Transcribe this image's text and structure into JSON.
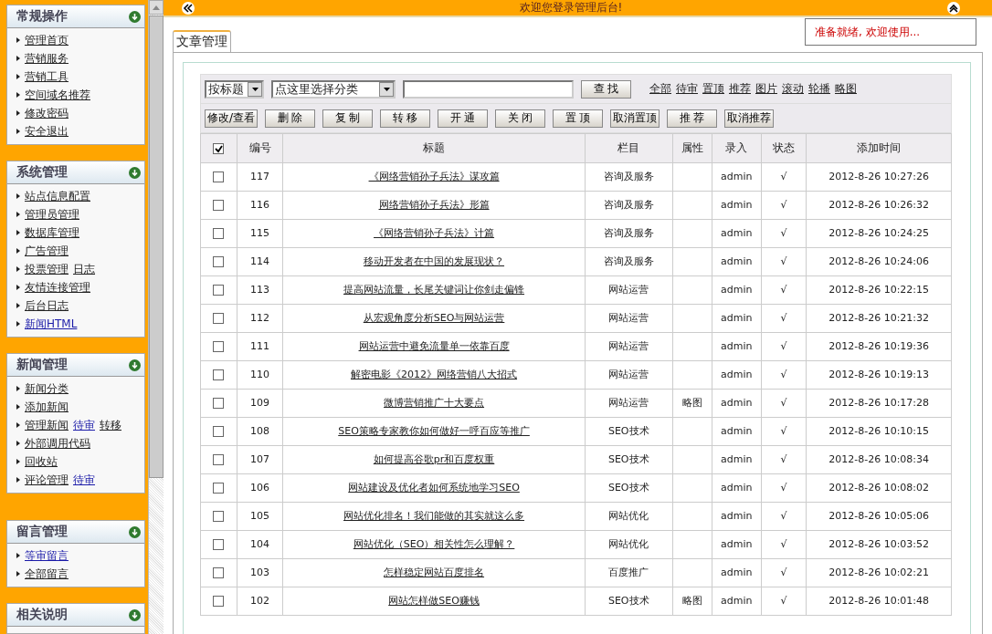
{
  "sidebar": {
    "sections": [
      {
        "title": "常规操作",
        "items": [
          {
            "links": [
              {
                "text": "管理首页",
                "highlighted": false
              }
            ]
          },
          {
            "links": [
              {
                "text": "营销服务",
                "highlighted": false
              }
            ]
          },
          {
            "links": [
              {
                "text": "营销工具",
                "highlighted": false
              }
            ]
          },
          {
            "links": [
              {
                "text": "空间域名推荐",
                "highlighted": false
              }
            ]
          },
          {
            "links": [
              {
                "text": "修改密码",
                "highlighted": false
              }
            ]
          },
          {
            "links": [
              {
                "text": "安全退出",
                "highlighted": false
              }
            ]
          }
        ]
      },
      {
        "title": "系统管理",
        "items": [
          {
            "links": [
              {
                "text": "站点信息配置",
                "highlighted": false
              }
            ]
          },
          {
            "links": [
              {
                "text": "管理员管理",
                "highlighted": false
              }
            ]
          },
          {
            "links": [
              {
                "text": "数据库管理",
                "highlighted": false
              }
            ]
          },
          {
            "links": [
              {
                "text": "广告管理",
                "highlighted": false
              }
            ]
          },
          {
            "links": [
              {
                "text": "投票管理",
                "highlighted": false
              },
              {
                "text": "日志",
                "highlighted": false
              }
            ]
          },
          {
            "links": [
              {
                "text": "友情连接管理",
                "highlighted": false
              }
            ]
          },
          {
            "links": [
              {
                "text": "后台日志",
                "highlighted": false
              }
            ]
          },
          {
            "links": [
              {
                "text": "新闻HTML",
                "highlighted": true
              }
            ]
          }
        ]
      },
      {
        "title": "新闻管理",
        "items": [
          {
            "links": [
              {
                "text": "新闻分类",
                "highlighted": false
              }
            ]
          },
          {
            "links": [
              {
                "text": "添加新闻",
                "highlighted": false
              }
            ]
          },
          {
            "links": [
              {
                "text": "管理新闻",
                "highlighted": false
              },
              {
                "text": "待审",
                "highlighted": true
              },
              {
                "text": "转移",
                "highlighted": false
              }
            ]
          },
          {
            "links": [
              {
                "text": "外部调用代码",
                "highlighted": false
              }
            ]
          },
          {
            "links": [
              {
                "text": "回收站",
                "highlighted": false
              }
            ]
          },
          {
            "links": [
              {
                "text": "评论管理",
                "highlighted": false
              },
              {
                "text": "待审",
                "highlighted": true
              }
            ]
          }
        ]
      },
      {
        "title": "留言管理",
        "items": [
          {
            "links": [
              {
                "text": "等审留言",
                "highlighted": true
              }
            ]
          },
          {
            "links": [
              {
                "text": "全部留言",
                "highlighted": false
              }
            ]
          }
        ]
      },
      {
        "title": "相关说明"
      }
    ]
  },
  "header": {
    "title": "欢迎您登录管理后台!"
  },
  "status": "准备就绪, 欢迎使用...",
  "tab": {
    "label": "文章管理",
    "selected": true
  },
  "search": {
    "field_select": "按标题",
    "category_select": "点这里选择分类",
    "button": "查 找",
    "filters": [
      "全部",
      "待审",
      "置顶",
      "推荐",
      "图片",
      "滚动",
      "轮播",
      "略图"
    ]
  },
  "actions": [
    "修改/查看",
    "删 除",
    "复 制",
    "转 移",
    "开 通",
    "关 闭",
    "置 顶",
    "取消置顶",
    "推 荐",
    "取消推荐"
  ],
  "table": {
    "header_checked": true,
    "columns": [
      "编号",
      "标题",
      "栏目",
      "属性",
      "录入",
      "状态",
      "添加时间"
    ],
    "rows": [
      {
        "checked": false,
        "cells": [
          "117",
          "《网络营销孙子兵法》谋攻篇",
          "咨询及服务",
          "",
          "admin",
          "√",
          "2012-8-26 10:27:26"
        ]
      },
      {
        "checked": false,
        "cells": [
          "116",
          "网络营销孙子兵法》形篇",
          "咨询及服务",
          "",
          "admin",
          "√",
          "2012-8-26 10:26:32"
        ]
      },
      {
        "checked": false,
        "cells": [
          "115",
          "《网络营销孙子兵法》计篇",
          "咨询及服务",
          "",
          "admin",
          "√",
          "2012-8-26 10:24:25"
        ]
      },
      {
        "checked": false,
        "cells": [
          "114",
          "移动开发者在中国的发展现状？",
          "咨询及服务",
          "",
          "admin",
          "√",
          "2012-8-26 10:24:06"
        ]
      },
      {
        "checked": false,
        "cells": [
          "113",
          "提高网站流量，长尾关键词让你剑走偏锋",
          "网站运营",
          "",
          "admin",
          "√",
          "2012-8-26 10:22:15"
        ]
      },
      {
        "checked": false,
        "cells": [
          "112",
          "从宏观角度分析SEO与网站运营",
          "网站运营",
          "",
          "admin",
          "√",
          "2012-8-26 10:21:32"
        ]
      },
      {
        "checked": false,
        "cells": [
          "111",
          "网站运营中避免流量单一依靠百度",
          "网站运营",
          "",
          "admin",
          "√",
          "2012-8-26 10:19:36"
        ]
      },
      {
        "checked": false,
        "cells": [
          "110",
          "解密电影《2012》网络营销八大招式",
          "网站运营",
          "",
          "admin",
          "√",
          "2012-8-26 10:19:13"
        ]
      },
      {
        "checked": false,
        "cells": [
          "109",
          "微博营销推广十大要点",
          "网站运营",
          "略图",
          "admin",
          "√",
          "2012-8-26 10:17:28"
        ]
      },
      {
        "checked": false,
        "cells": [
          "108",
          "SEO策略专家教你如何做好一呼百应等推广",
          "SEO技术",
          "",
          "admin",
          "√",
          "2012-8-26 10:10:15"
        ]
      },
      {
        "checked": false,
        "cells": [
          "107",
          "如何提高谷歌pr和百度权重",
          "SEO技术",
          "",
          "admin",
          "√",
          "2012-8-26 10:08:34"
        ]
      },
      {
        "checked": false,
        "cells": [
          "106",
          "网站建设及优化者如何系统地学习SEO",
          "SEO技术",
          "",
          "admin",
          "√",
          "2012-8-26 10:08:02"
        ]
      },
      {
        "checked": false,
        "cells": [
          "105",
          "网站优化排名！我们能做的其实就这么多",
          "网站优化",
          "",
          "admin",
          "√",
          "2012-8-26 10:05:06"
        ]
      },
      {
        "checked": false,
        "cells": [
          "104",
          "网站优化（SEO）相关性怎么理解？",
          "网站优化",
          "",
          "admin",
          "√",
          "2012-8-26 10:03:52"
        ]
      },
      {
        "checked": false,
        "cells": [
          "103",
          "怎样稳定网站百度排名",
          "百度推广",
          "",
          "admin",
          "√",
          "2012-8-26 10:02:21"
        ]
      },
      {
        "checked": false,
        "cells": [
          "102",
          "网站怎样做SEO赚钱",
          "SEO技术",
          "略图",
          "admin",
          "√",
          "2012-8-26 10:01:48"
        ]
      }
    ]
  }
}
